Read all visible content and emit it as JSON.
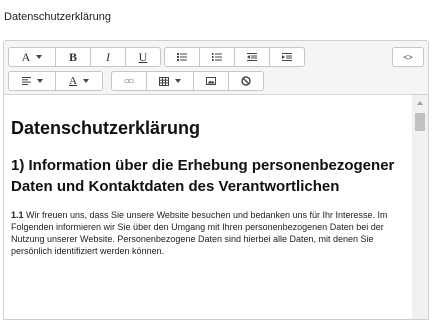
{
  "field": {
    "label": "Datenschutzerklärung"
  },
  "toolbar": {
    "font_label": "A",
    "bold_label": "B",
    "italic_label": "I",
    "underline_label": "U",
    "code_view_label": "<>",
    "color_label": "A",
    "icons": [
      "font-icon",
      "bold-icon",
      "italic-icon",
      "underline-icon",
      "unordered-list-icon",
      "ordered-list-icon",
      "outdent-icon",
      "indent-icon",
      "code-view-icon",
      "paragraph-align-icon",
      "font-color-icon",
      "link-icon",
      "table-icon",
      "picture-icon",
      "clear-format-icon"
    ]
  },
  "content": {
    "heading": "Datenschutzerklärung",
    "subheading": "1) Information über die Erhebung personenbezogener Daten und Kontaktdaten des Verantwortlichen",
    "paragraph_num": "1.1",
    "paragraph_text": " Wir freuen uns, dass Sie unsere Website besuchen und bedanken uns für Ihr Interesse. Im Folgenden informieren wir Sie über den Umgang mit Ihren personenbezogenen Daten bei der Nutzung unserer Website. Personenbezogene Daten sind hierbei alle Daten, mit denen Sie persönlich identifiziert werden können."
  },
  "colors": {
    "toolbar_bg": "#f5f5f5",
    "border": "#c6c6c6",
    "scroll_thumb": "#c1c1c1"
  }
}
